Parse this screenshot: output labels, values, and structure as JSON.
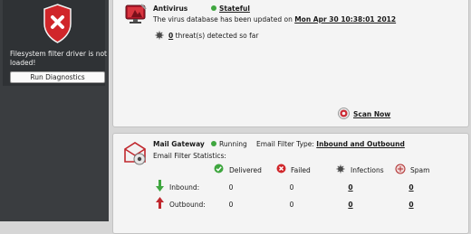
{
  "sidebar": {
    "error_text": "Filesystem filter driver is not loaded!",
    "diagnostics_button": "Run Diagnostics"
  },
  "antivirus": {
    "title": "Antivirus",
    "status": "Stateful",
    "db_text": "The virus database has been updated on",
    "db_date": "Mon Apr 30 10:38:01 2012",
    "threats_count": "0",
    "threats_text": "threat(s) detected so far",
    "scan_now": "Scan Now"
  },
  "mail": {
    "title": "Mail Gateway",
    "status": "Running",
    "filter_type_label": "Email Filter Type:",
    "filter_type_value": "Inbound and Outbound",
    "stats_label": "Email Filter Statistics:",
    "columns": [
      "Delivered",
      "Failed",
      "Infections",
      "Spam"
    ],
    "rows": [
      {
        "label": "Inbound:",
        "delivered": "0",
        "failed": "0",
        "infections": "0",
        "spam": "0"
      },
      {
        "label": "Outbound:",
        "delivered": "0",
        "failed": "0",
        "infections": "0",
        "spam": "0"
      }
    ]
  },
  "colors": {
    "sidebar": "#3a3d40",
    "ok_green": "#3fa63f",
    "error_red": "#d0262a"
  }
}
